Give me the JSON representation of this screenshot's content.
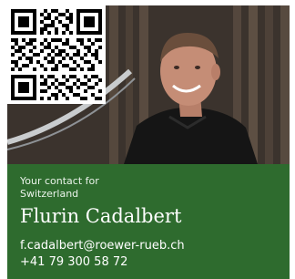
{
  "contact_card": {
    "label_line1": "Your contact for",
    "label_line2": "Switzerland",
    "name": "Flurin Cadalbert",
    "email": "f.cadalbert@roewer-rueb.ch",
    "phone": "+41 79 300 58 72"
  },
  "colors": {
    "panel_green": "#2e6b2e",
    "text_white": "#ffffff"
  },
  "icons": {
    "qr": "qr-code-icon"
  }
}
